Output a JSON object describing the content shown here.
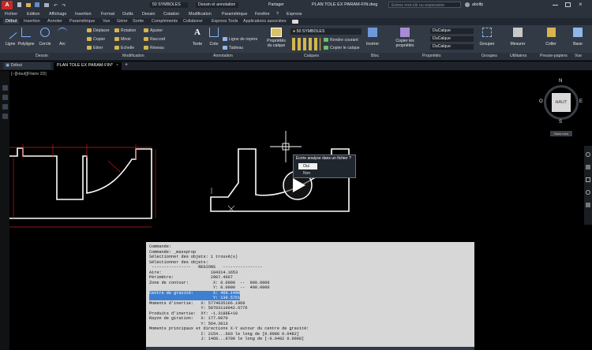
{
  "app": {
    "quick_access_label": "50 SYMBOLES",
    "workspace_label": "Dessin et annotation",
    "share_label": "Partager",
    "file_title": "PLAN TOLE EX PARAM-FIN.dwg",
    "search_placeholder": "Entrez mot-clé ou expression",
    "user": "abolfp"
  },
  "menu": [
    "Fichier",
    "Edition",
    "Affichage",
    "Insertion",
    "Format",
    "Outils",
    "Dessin",
    "Cotation",
    "Modification",
    "Paramétrique",
    "Fenêtre",
    "?",
    "Express"
  ],
  "ribbon_tabs": [
    "Début",
    "Insertion",
    "Annoter",
    "Paramétrique",
    "Vue",
    "Gérer",
    "Sortie",
    "Compléments",
    "Collaborer",
    "Express Tools",
    "Applications associées"
  ],
  "ribbon": {
    "draw": [
      "Ligne",
      "Polyligne",
      "Cercle",
      "Arc"
    ],
    "modify": [
      "Déplacer",
      "Rotation",
      "Ajuster",
      "Copier",
      "Miroir",
      "Raccord",
      "Etirer",
      "Echelle",
      "Réseau"
    ],
    "annotation": [
      "Texte",
      "Cote",
      "Ligne de repère",
      "Tableau"
    ],
    "layers": {
      "props": "Propriétés du calque",
      "current": "50 SYMBOLES",
      "make_current": "Rendre courant",
      "copy_to_layer": "Copier le calque"
    },
    "block": [
      "Insérer"
    ],
    "properties": {
      "match": "Copier les propriétés",
      "layer": "DuCalque",
      "linetype": "DuCalque",
      "lineweight": "DuCalque"
    },
    "groups": [
      "Grouper"
    ],
    "utilities": [
      "Mesurer"
    ],
    "clipboard": [
      "Coller"
    ],
    "view": [
      "Base"
    ],
    "group_labels": [
      "Dessin",
      "Modification",
      "Annotation",
      "Calques",
      "Bloc",
      "Propriétés",
      "Groupes",
      "Utilitaires",
      "Presse-papiers",
      "Vue"
    ]
  },
  "doc_tabs": [
    "Début",
    "PLAN TOLE EX PARAM-FIN*"
  ],
  "viewport_label": "[–][Haut][Filaire 2D]",
  "viewcube": {
    "top": "HAUT",
    "n": "N",
    "s": "S",
    "e": "E",
    "w": "O",
    "wcs": "Sans nom"
  },
  "dialog": {
    "title": "Ecrire analyse dans un fichier ?",
    "options": [
      "Oui",
      "Non"
    ]
  },
  "command_lines": [
    "Commande:",
    "Commande: _massprop",
    "Sélectionner des objets: 1 trouvé(s)",
    "Sélectionner des objets:",
    " ----------------   REGIONS   ----------------",
    "Aire:                    184314.1653",
    "Périmètre:               2987.4667",
    "Zone de contour:          X: 0.0000  --  900.0000",
    "                          Y: 0.0000  --  400.0000",
    "Centre de gravité:        X: 409.1490",
    "                          Y: 139.5751",
    "Moments d'inertie:   X: 5774035166.1969",
    "                     Y: 58703110042.6776",
    "Produits d'inertie:  XY: -1.3188E+10",
    "Rayon de giration:   X: 177.0070",
    "                     Y: 564.3613",
    "Moments principaux et directions X-Y autour du centre de gravité:",
    "                     I: 2154...603 le long de [0.9988 0.0482]",
    "                     J: 1469...9700 le long de [-0.0482 0.9988]"
  ],
  "colors": {
    "accent": "#3f7fcf",
    "ribbon": "#323a46",
    "canvas": "#000000"
  }
}
